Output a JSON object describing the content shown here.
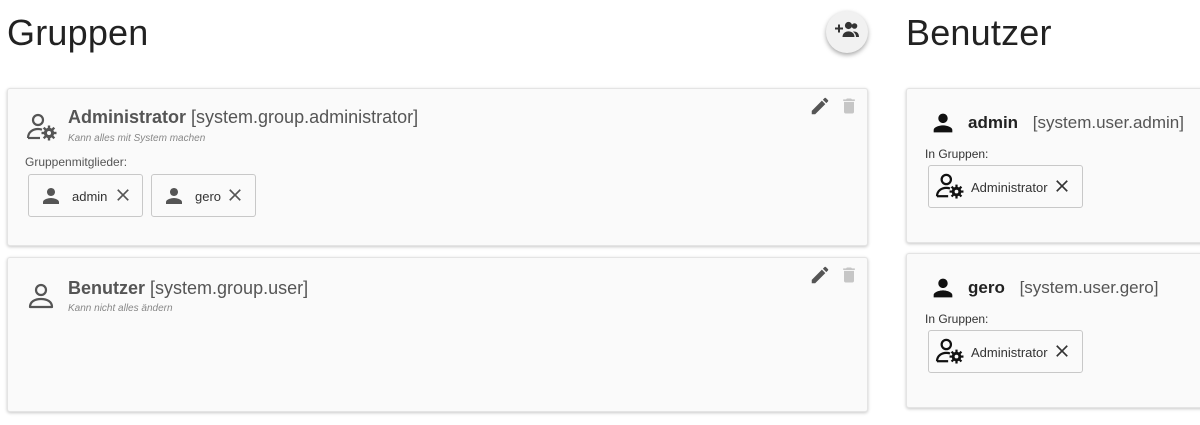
{
  "groups_section": {
    "title": "Gruppen",
    "groups": [
      {
        "name": "Administrator",
        "id": "[system.group.administrator]",
        "description": "Kann alles mit System machen",
        "members_label": "Gruppenmitglieder:",
        "members": [
          "admin",
          "gero"
        ]
      },
      {
        "name": "Benutzer",
        "id": "[system.group.user]",
        "description": "Kann nicht alles ändern"
      }
    ]
  },
  "users_section": {
    "title": "Benutzer",
    "users": [
      {
        "name": "admin",
        "id": "[system.user.admin]",
        "groups_label": "In Gruppen:",
        "groups": [
          "Administrator"
        ]
      },
      {
        "name": "gero",
        "id": "[system.user.gero]",
        "groups_label": "In Gruppen:",
        "groups": [
          "Administrator"
        ]
      }
    ]
  },
  "icons": {
    "fab": "group-add-icon",
    "edit": "pencil-icon",
    "delete": "trash-icon",
    "admin_group": "user-gear-icon",
    "user_group": "person-outline-icon",
    "user": "person-icon",
    "remove": "close-icon"
  },
  "colors": {
    "card_bg": "#fafafa",
    "icon_dark": "#555555",
    "icon_light": "#bdbdbd"
  }
}
